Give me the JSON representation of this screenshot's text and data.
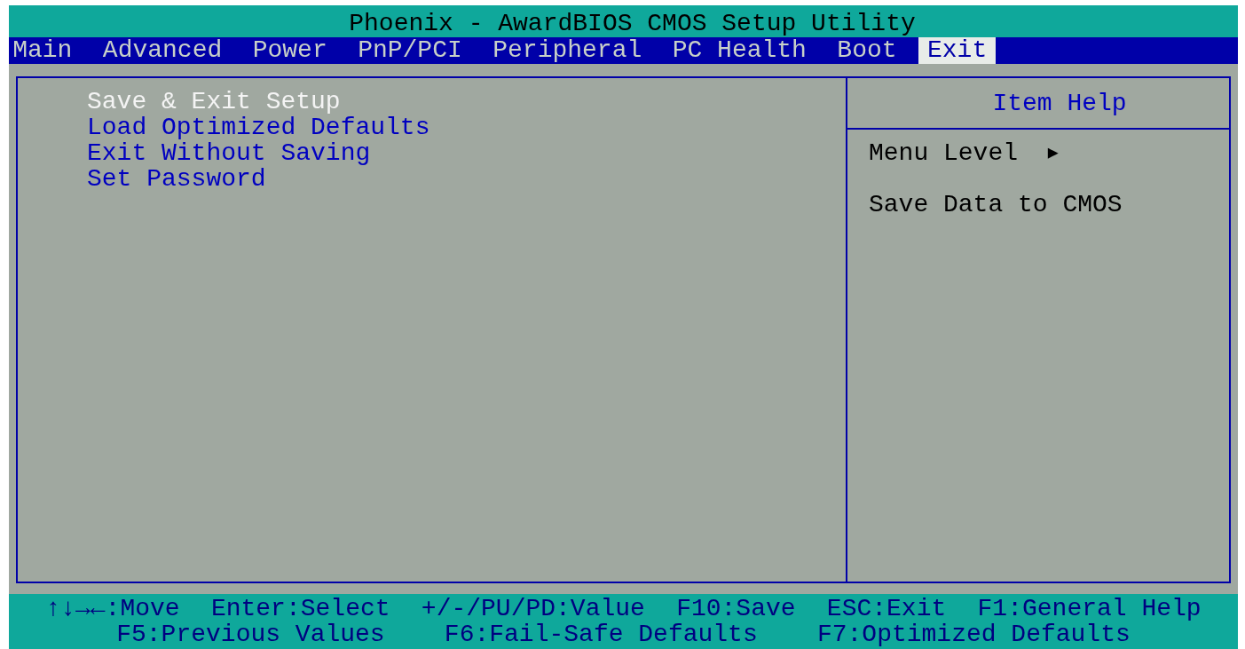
{
  "title": "Phoenix - AwardBIOS CMOS Setup Utility",
  "tabs": [
    {
      "label": "Main",
      "selected": false
    },
    {
      "label": "Advanced",
      "selected": false
    },
    {
      "label": "Power",
      "selected": false
    },
    {
      "label": "PnP/PCI",
      "selected": false
    },
    {
      "label": "Peripheral",
      "selected": false
    },
    {
      "label": "PC Health",
      "selected": false
    },
    {
      "label": "Boot",
      "selected": false
    },
    {
      "label": "Exit",
      "selected": true
    }
  ],
  "menu_items": [
    {
      "label": "Save & Exit Setup",
      "selected": true
    },
    {
      "label": "Load Optimized Defaults",
      "selected": false
    },
    {
      "label": "Exit Without Saving",
      "selected": false
    },
    {
      "label": "Set Password",
      "selected": false
    }
  ],
  "item_help": {
    "title": "Item Help",
    "menu_level": {
      "label": "Menu Level",
      "marker": "▶"
    },
    "description": "Save Data to CMOS"
  },
  "key_hints": [
    [
      "↑↓→←:Move",
      "Enter:Select",
      "+/-/PU/PD:Value",
      "F10:Save",
      "ESC:Exit",
      "F1:General Help"
    ],
    [
      "F5:Previous Values",
      "F6:Fail-Safe Defaults",
      "F7:Optimized Defaults"
    ]
  ]
}
